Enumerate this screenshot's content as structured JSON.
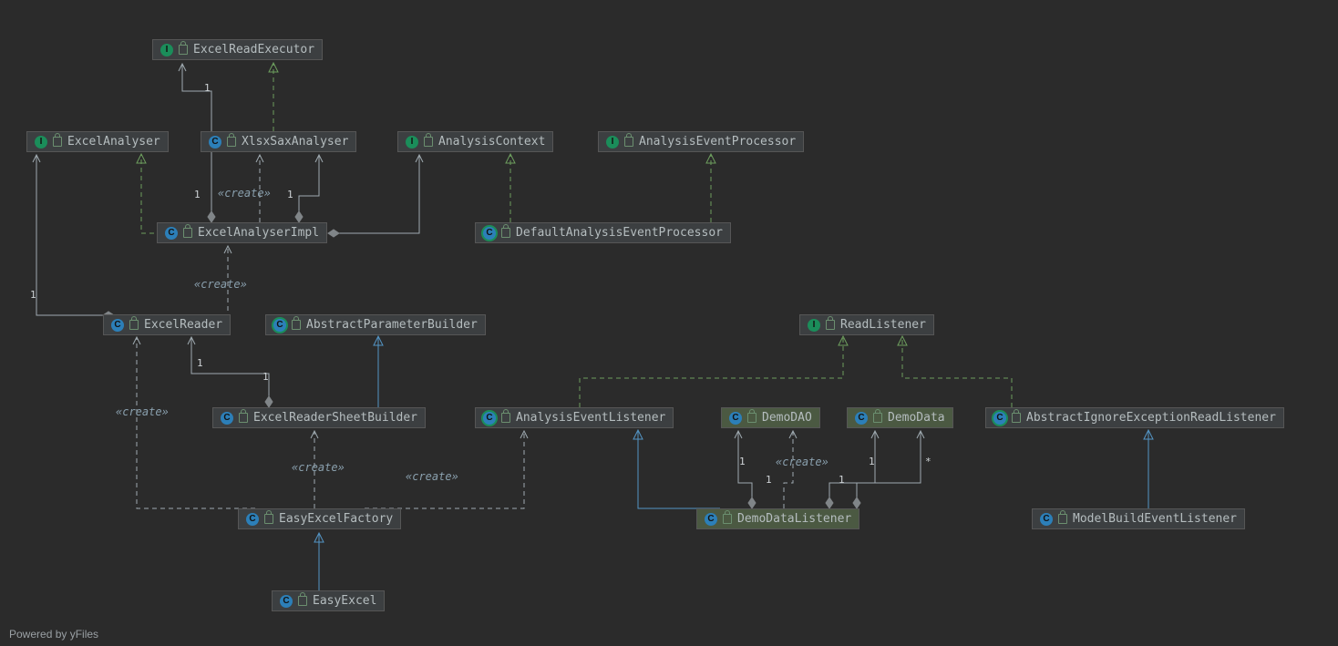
{
  "attribution": "Powered by yFiles",
  "create": "«create»",
  "m": {
    "one": "1",
    "star": "*"
  },
  "node": {
    "excelReadExecutor": "ExcelReadExecutor",
    "excelAnalyser": "ExcelAnalyser",
    "xlsxSaxAnalyser": "XlsxSaxAnalyser",
    "analysisContext": "AnalysisContext",
    "analysisEventProcessor": "AnalysisEventProcessor",
    "excelAnalyserImpl": "ExcelAnalyserImpl",
    "defaultAnalysisEventProcessor": "DefaultAnalysisEventProcessor",
    "excelReader": "ExcelReader",
    "abstractParameterBuilder": "AbstractParameterBuilder",
    "readListener": "ReadListener",
    "excelReaderSheetBuilder": "ExcelReaderSheetBuilder",
    "analysisEventListener": "AnalysisEventListener",
    "demoDAO": "DemoDAO",
    "demoData": "DemoData",
    "abstractIgnoreExceptionReadListener": "AbstractIgnoreExceptionReadListener",
    "easyExcelFactory": "EasyExcelFactory",
    "demoDataListener": "DemoDataListener",
    "modelBuildEventListener": "ModelBuildEventListener",
    "easyExcel": "EasyExcel"
  }
}
